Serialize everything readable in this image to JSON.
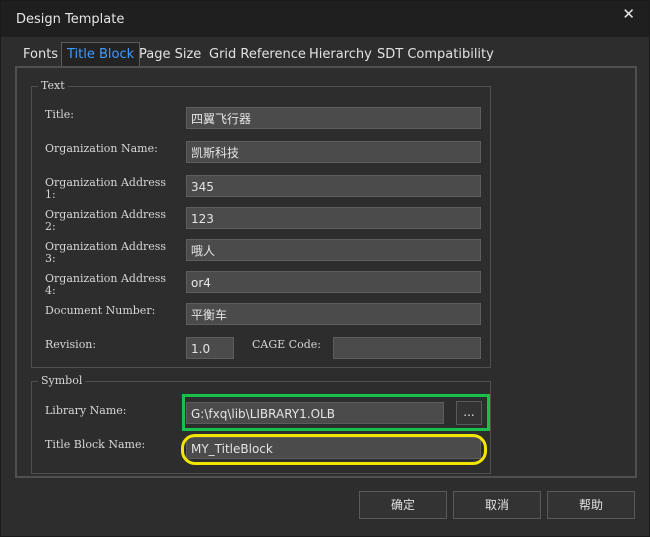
{
  "window": {
    "title": "Design Template",
    "close_glyph": "✕"
  },
  "tabs": [
    {
      "label": "Fonts"
    },
    {
      "label": "Title Block"
    },
    {
      "label": "Page Size"
    },
    {
      "label": "Grid Reference"
    },
    {
      "label": "Hierarchy"
    },
    {
      "label": "SDT Compatibility"
    }
  ],
  "active_tab": "Title Block",
  "text_group": {
    "legend": "Text",
    "title": {
      "label": "Title:",
      "value": "四翼飞行器"
    },
    "org_name": {
      "label": "Organization Name:",
      "value": "凯斯科技"
    },
    "addr1": {
      "label": "Organization Address\n1:",
      "value": "345"
    },
    "addr2": {
      "label": "Organization Address\n2:",
      "value": "123"
    },
    "addr3": {
      "label": "Organization Address\n3:",
      "value": "哦人"
    },
    "addr4": {
      "label": "Organization Address\n4:",
      "value": "or4"
    },
    "doc_number": {
      "label": "Document Number:",
      "value": "平衡车"
    },
    "revision": {
      "label": "Revision:",
      "value": "1.0"
    },
    "cage_code": {
      "label": "CAGE Code:",
      "value": ""
    }
  },
  "symbol_group": {
    "legend": "Symbol",
    "library_name": {
      "label": "Library Name:",
      "value": "G:\\fxq\\lib\\LIBRARY1.OLB",
      "browse_label": "..."
    },
    "title_block_name": {
      "label": "Title Block Name:",
      "value": "MY_TitleBlock"
    }
  },
  "buttons": {
    "ok": "确定",
    "cancel": "取消",
    "help": "帮助"
  },
  "highlights": {
    "library_box_color": "#19c14a",
    "title_block_ellipse_color": "#f2e600"
  }
}
